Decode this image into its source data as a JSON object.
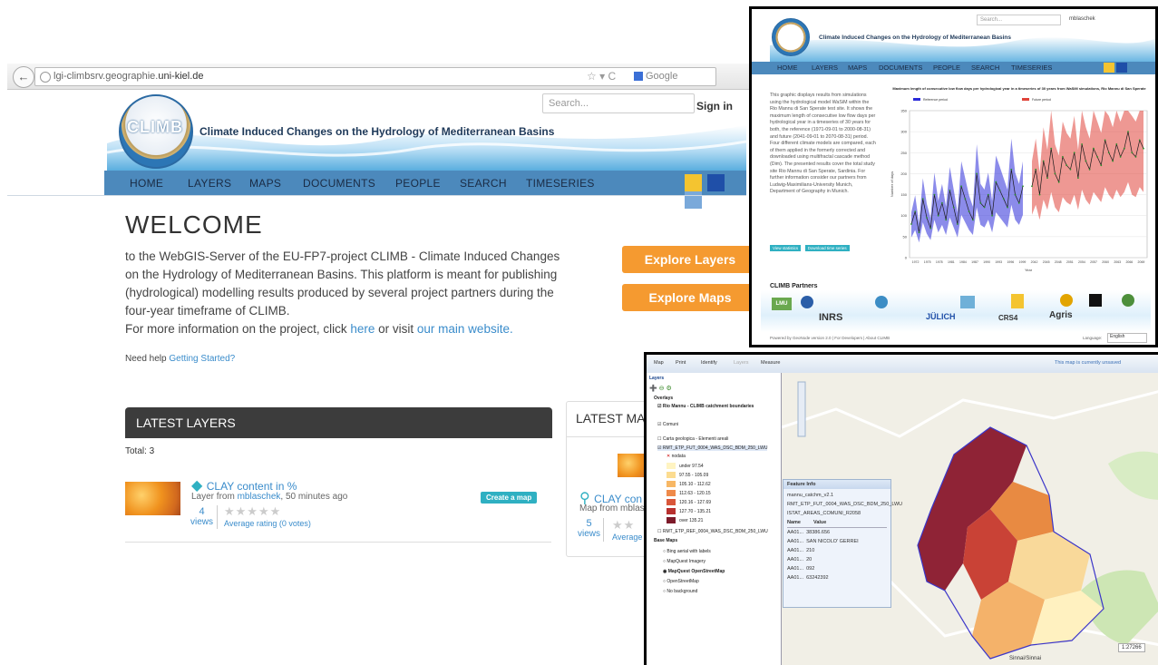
{
  "browser": {
    "url_host": "lgi-climbsrv.geographie.",
    "url_domain": "uni-kiel.de",
    "search_engine": "Google"
  },
  "header": {
    "logo_text": "CLIMB",
    "site_title": "Climate Induced Changes on the Hydrology of Mediterranean Basins",
    "search_placeholder": "Search...",
    "signin": "Sign in"
  },
  "nav": [
    "HOME",
    "LAYERS",
    "MAPS",
    "DOCUMENTS",
    "PEOPLE",
    "SEARCH",
    "TIMESERIES"
  ],
  "welcome": {
    "title": "WELCOME",
    "text": "to the WebGIS-Server of the EU-FP7-project CLIMB - Climate Induced Changes on the Hydrology of Mediterranean Basins. This platform is meant for publishing (hydrological) modelling results produced by several project partners during the four-year timeframe of CLIMB.",
    "more_prefix": "For more information on the project, click ",
    "more_link1": "here",
    "more_mid": " or visit ",
    "more_link2": "our main website.",
    "need_help": "Need help ",
    "getting_started": "Getting Started?"
  },
  "buttons": {
    "explore_layers": "Explore Layers",
    "explore_maps": "Explore Maps"
  },
  "latest_layers": {
    "heading": "LATEST LAYERS",
    "total": "Total: 3",
    "item_title": "CLAY content in %",
    "item_sub_prefix": "Layer from ",
    "item_user": "mblaschek",
    "item_time": ", 50 minutes ago",
    "views_count": "4",
    "views_label": "views",
    "rating": "Average rating (0 votes)",
    "create_map": "Create a map"
  },
  "latest_maps": {
    "heading": "LATEST MA",
    "item_title": "CLAY con",
    "item_sub": "Map from mblas",
    "views_count": "5",
    "views_label": "views",
    "rating": "Average r"
  },
  "timeseries_shot": {
    "search_placeholder": "Search...",
    "user": "mblaschek",
    "site_title": "Climate Induced Changes on the Hydrology of Mediterranean Basins",
    "nav": [
      "HOME",
      "LAYERS",
      "MAPS",
      "DOCUMENTS",
      "PEOPLE",
      "SEARCH",
      "TIMESERIES"
    ],
    "chart_title": "Maximum length of consecutive low flow days per hydrological year in a timeseries of 30 years from WaSiM simulations, Rio Mannu di San Sperate",
    "description": "This graphic displays results from simulations using the hydrological model WaSiM within the Rio Mannu di San Sperate test site. It shows the maximum length of consecutive low flow days per hydrological year in a timeseries of 30 years for both, the reference (1971-09-01 to 2000-08-31) and future (2041-09-01 to 2070-08-31) period. Four different climate models are compared, each of them applied in the formerly corrected and downloaded using multifractal cascade method (Dim). The presented results cover the total study site Rio Mannu di San Sperate, Sardinia. For further information consider our partners from Ludwig-Maximilians-University Munich, Department of Geography in Munich.",
    "btn1": "View statistics",
    "btn2": "Download time series",
    "partners_title": "CLIMB Partners",
    "partners": [
      "LMU",
      "INRS",
      "JÜLICH",
      "CRS4",
      "Agris"
    ],
    "footer": "Powered by GeoNode version 2.0 | For Developers | About CLIMB",
    "language_label": "Language:",
    "language": "English"
  },
  "chart_data": {
    "type": "line",
    "title": "Maximum length of consecutive low flow days per hydrological year in a timeseries of 30 years from WaSiM simulations, Rio Mannu di San Sperate",
    "ylabel": "Number of days",
    "xlabel": "Year",
    "ylim": [
      0,
      350
    ],
    "x_ticks": [
      "1972",
      "1975",
      "1978",
      "1981",
      "1984",
      "1987",
      "1990",
      "1993",
      "1996",
      "1999",
      "2042",
      "2045",
      "2048",
      "2051",
      "2054",
      "2057",
      "2060",
      "2063",
      "2066",
      "2069"
    ],
    "y_ticks": [
      "0",
      "50",
      "100",
      "150",
      "200",
      "250",
      "300",
      "350"
    ],
    "series": [
      {
        "name": "Reference period",
        "color": "#2b2bd9",
        "values": [
          80,
          110,
          60,
          140,
          95,
          70,
          150,
          100,
          130,
          90,
          160,
          120,
          80,
          170,
          140,
          110,
          90,
          200,
          130,
          120,
          150,
          100,
          180,
          160,
          140,
          120,
          210,
          150,
          130,
          170
        ]
      },
      {
        "name": "Future period",
        "color": "#e0443a",
        "values": [
          170,
          210,
          150,
          230,
          190,
          260,
          200,
          180,
          240,
          220,
          210,
          250,
          190,
          270,
          230,
          210,
          260,
          240,
          220,
          280,
          250,
          230,
          270,
          240,
          260,
          300,
          250,
          240,
          280,
          260
        ]
      }
    ]
  },
  "gis_shot": {
    "toolbar": [
      "Map",
      "Print",
      "Identify",
      "Layers",
      "Measure"
    ],
    "status": "This map is currently unsaved",
    "layers_title": "Layers",
    "overlays": "Overlays",
    "layer1": "Rio Mannu - CLIMB catchment boundaries",
    "layer2": "Comuni",
    "layer3": "Carta geologica - Elementi areali",
    "layer4": "RMT_ETP_FUT_0004_WAS_DSC_BDM_250_LWU",
    "legend": [
      "nodata",
      "under 97.54",
      "97.55 - 105.09",
      "105.10 - 112.62",
      "112.63 - 120.15",
      "120.16 - 127.69",
      "127.70 - 135.21",
      "over 135.21"
    ],
    "legend_colors": [
      "#ffffff",
      "#fff4c2",
      "#fcdc90",
      "#f7b765",
      "#ef8a4a",
      "#d9573a",
      "#b8312f",
      "#7d1a2a"
    ],
    "layer5": "RMT_ETP_REF_0004_WAS_DSC_BDM_250_LWU",
    "base_maps": "Base Maps",
    "base_list": [
      "Bing aerial with labels",
      "MapQuest Imagery",
      "MapQuest OpenStreetMap",
      "OpenStreetMap",
      "No background"
    ],
    "feature_info": "Feature Info",
    "fi_rows": [
      "mannu_catchm_v2.1",
      "RMT_ETP_FUT_0004_WAS_DSC_BDM_250_LWU",
      "ISTAT_AREAS_COMUNI_R2058"
    ],
    "fi_cols": [
      "Name",
      "Value"
    ],
    "fi_values": [
      [
        "AA01...",
        "38386.656"
      ],
      [
        "AA01...",
        "SAN NICOLO' GERREI"
      ],
      [
        "AA01...",
        "210"
      ],
      [
        "AA01...",
        "20"
      ],
      [
        "AA01...",
        "092"
      ],
      [
        "AA01...",
        "63242392"
      ]
    ],
    "place_label": "Sinnai/Sinnai",
    "scale": "1:27266"
  }
}
